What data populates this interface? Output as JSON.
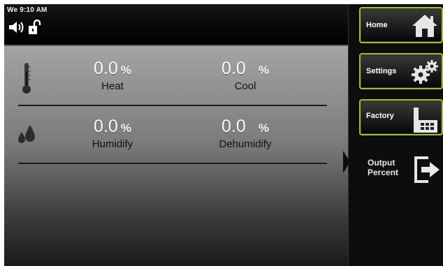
{
  "status": {
    "clock": "We 9:10 AM",
    "speaker_icon": "speaker-icon",
    "lock_icon": "unlocked-icon"
  },
  "rows": [
    {
      "icon": "thermometer-icon",
      "items": [
        {
          "value": "0.0",
          "unit": "%",
          "label": "Heat"
        },
        {
          "value": "0.0",
          "unit": "%",
          "label": "Cool"
        }
      ]
    },
    {
      "icon": "water-drops-icon",
      "items": [
        {
          "value": "0.0",
          "unit": "%",
          "label": "Humidify"
        },
        {
          "value": "0.0",
          "unit": "%",
          "label": "Dehumidify"
        }
      ]
    }
  ],
  "menu": {
    "home": {
      "label": "Home",
      "icon": "house-icon"
    },
    "settings": {
      "label": "Settings",
      "icon": "gears-icon"
    },
    "factory": {
      "label": "Factory",
      "icon": "factory-icon"
    },
    "active": {
      "label_line1": "Output",
      "label_line2": "Percent",
      "icon": "exit-arrow-icon"
    }
  },
  "colors": {
    "accent": "#97c23c",
    "panel_top": "#a4a4a4",
    "panel_bottom": "#1a1a1a"
  }
}
